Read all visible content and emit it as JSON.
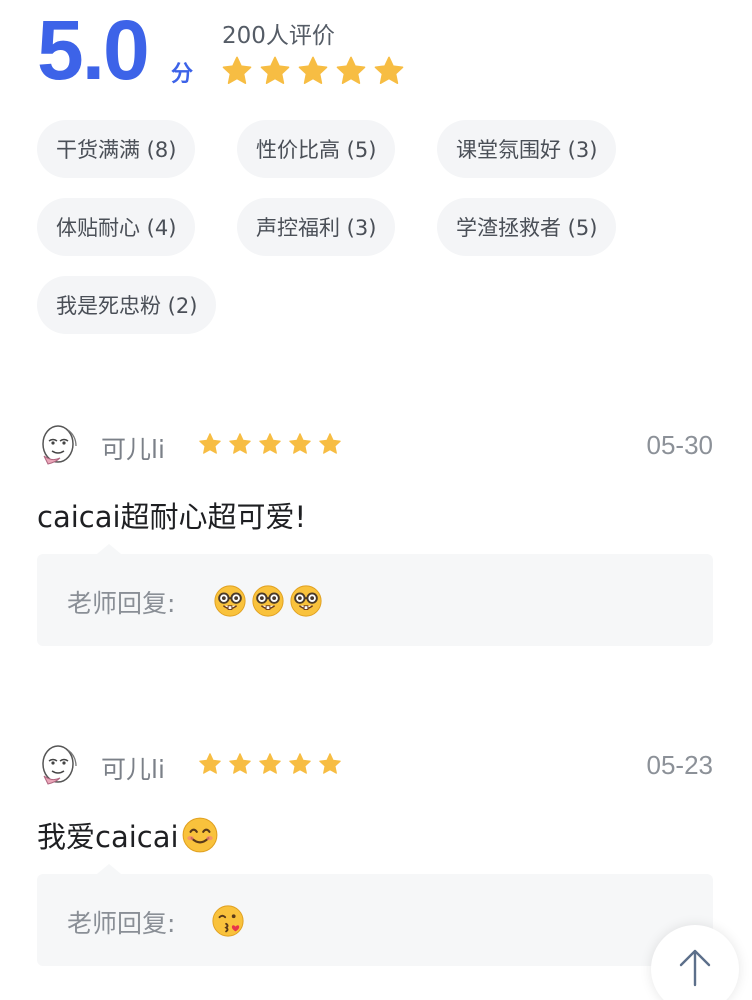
{
  "summary": {
    "score": "5.0",
    "unit": "分",
    "count": "200人评价",
    "rating": 5,
    "star_color": "#f7bd43"
  },
  "tags": [
    "干货满满 (8)",
    "性价比高 (5)",
    "课堂氛围好 (3)",
    "体贴耐心 (4)",
    "声控福利 (3)",
    "学渣拯救者 (5)",
    "我是死忠粉 (2)"
  ],
  "reviews": [
    {
      "user": "可儿li",
      "rating": 5,
      "date": "05-30",
      "text": "caicai超耐心超可爱!",
      "reply_label": "老师回复:",
      "reply_emojis": [
        "nerd-face",
        "nerd-face",
        "nerd-face"
      ]
    },
    {
      "user": "可儿li",
      "rating": 5,
      "date": "05-23",
      "text": "我爱caicai",
      "text_emoji": "smiling-face",
      "reply_label": "老师回复:",
      "reply_emojis": [
        "kissing-face"
      ]
    }
  ],
  "icons": {
    "star": "star-icon",
    "avatar": "sketch-avatar-icon",
    "scroll_top": "arrow-up-icon"
  },
  "colors": {
    "accent": "#3d63e8",
    "star": "#f7bd43",
    "tag_bg": "#f4f5f7",
    "reply_bg": "#f6f7f8"
  }
}
